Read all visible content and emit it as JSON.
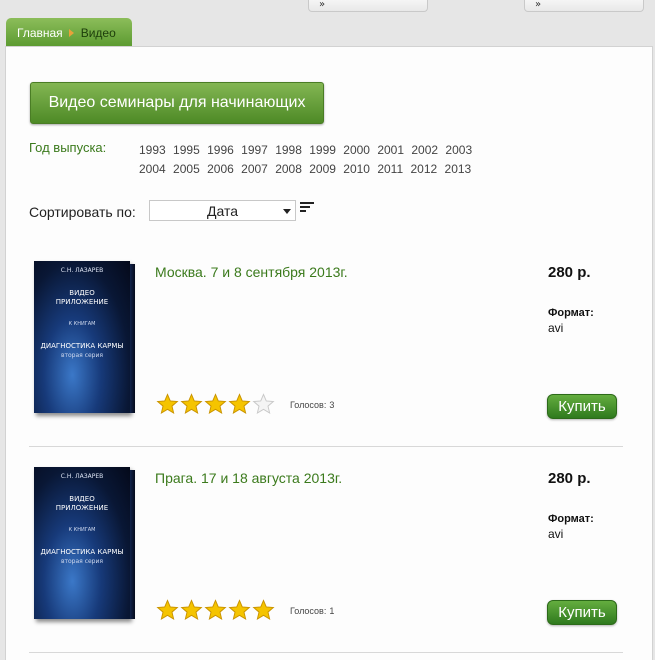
{
  "top_strip": [
    "»",
    "»"
  ],
  "breadcrumb": {
    "home": "Главная",
    "current": "Видео"
  },
  "section_button": "Видео семинары для начинающих",
  "year_filter": {
    "label": "Год выпуска:",
    "years": [
      "1993",
      "1995",
      "1996",
      "1997",
      "1998",
      "1999",
      "2000",
      "2001",
      "2002",
      "2003",
      "2004",
      "2005",
      "2006",
      "2007",
      "2008",
      "2009",
      "2010",
      "2011",
      "2012",
      "2013"
    ]
  },
  "sort": {
    "label": "Сортировать по:",
    "selected": "Дата"
  },
  "cover": {
    "author": "С.Н. ЛАЗАРЕВ",
    "line1": "ВИДЕО",
    "line2": "ПРИЛОЖЕНИЕ",
    "line3": "К КНИГАМ",
    "line4": "ДИАГНОСТИКА КАРМЫ",
    "line5": "вторая серия"
  },
  "products": [
    {
      "title": "Москва. 7 и 8 сентября 2013г.",
      "price": "280 р.",
      "format_label": "Формат:",
      "format_value": "avi",
      "rating": 4,
      "rating_max": 5,
      "votes_label": "Голосов:",
      "votes_count": "3",
      "buy_label": "Купить"
    },
    {
      "title": "Прага. 17 и 18 августа 2013г.",
      "price": "280 р.",
      "format_label": "Формат:",
      "format_value": "avi",
      "rating": 5,
      "rating_max": 5,
      "votes_label": "Голосов:",
      "votes_count": "1",
      "buy_label": "Купить"
    }
  ],
  "colors": {
    "accent_green": "#3b7a1c",
    "button_green": "#5b9a30",
    "star_gold": "#f5c400"
  }
}
